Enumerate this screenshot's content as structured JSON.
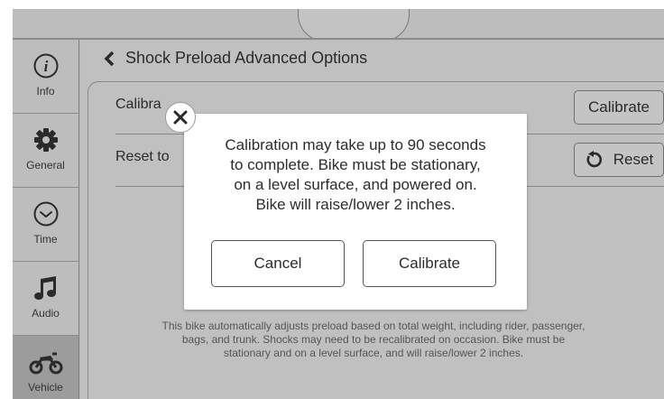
{
  "sidebar": {
    "items": [
      {
        "label": "Info",
        "icon": "info-icon"
      },
      {
        "label": "General",
        "icon": "gear-icon"
      },
      {
        "label": "Time",
        "icon": "clock-icon"
      },
      {
        "label": "Audio",
        "icon": "music-note-icon"
      },
      {
        "label": "Vehicle",
        "icon": "motorcycle-icon",
        "active": true
      }
    ]
  },
  "header": {
    "title": "Shock Preload Advanced Options",
    "back_icon": "chevron-left-icon"
  },
  "options": {
    "calibrate_label": "Calibra",
    "calibrate_button": "Calibrate",
    "reset_label": "Reset to",
    "reset_button": "Reset",
    "reset_icon": "undo-arrow-icon"
  },
  "description": "This bike automatically adjusts preload based on total weight, including rider, passenger, bags, and trunk. Shocks may need to be recalibrated on occasion. Bike must be stationary and on a level surface, and will raise/lower 2 inches.",
  "modal": {
    "message_lines": [
      "Calibration may take up to 90 seconds",
      "to complete. Bike must be stationary,",
      "on a level surface, and powered on.",
      "Bike will raise/lower 2 inches."
    ],
    "cancel_label": "Cancel",
    "confirm_label": "Calibrate",
    "close_icon": "close-icon"
  },
  "colors": {
    "screen_bg": "#bdbdbd",
    "active_tab_bg": "#9c9c9c",
    "modal_bg": "#ffffff"
  }
}
